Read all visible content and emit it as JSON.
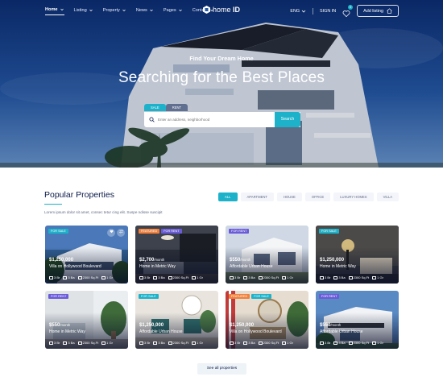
{
  "nav": {
    "items": [
      {
        "label": "Home",
        "active": true
      },
      {
        "label": "Listing",
        "active": false
      },
      {
        "label": "Property",
        "active": false
      },
      {
        "label": "News",
        "active": false
      },
      {
        "label": "Pages",
        "active": false
      },
      {
        "label": "Contact",
        "active": false
      }
    ],
    "logo": {
      "pre": "home",
      "bold": "ID"
    },
    "lang": "ENG",
    "signin": "SIGN IN",
    "wishlist_count": "0",
    "add_listing": "Add listing"
  },
  "hero": {
    "subtitle": "Find Your Dream Home",
    "title": "Searching for the Best Places",
    "tabs": [
      "SALE",
      "RENT"
    ],
    "search_placeholder": "Enter an address, neighborhood",
    "search_button": "Search"
  },
  "popular": {
    "title": "Popular Properties",
    "description": "Lorem ipsum dolor sit amet, consec tetur cing elit. Suspe ndisse suscipit",
    "filters": [
      "ALL",
      "APARTMENT",
      "HOUSE",
      "OFFICE",
      "LUXURY HOMES",
      "VILLA"
    ],
    "cards": [
      {
        "tags": [
          {
            "text": "FOR SALE",
            "kind": "sale"
          }
        ],
        "price": "$1,250,000",
        "per": "",
        "title": "Villa on Hollywood Boulevard",
        "br": "3 Br",
        "ba": "3 Ba",
        "area": "2300 Sq.Ft",
        "gr": "1 Gr",
        "actions": true,
        "photo": "villa"
      },
      {
        "tags": [
          {
            "text": "FEATURED",
            "kind": "featured"
          },
          {
            "text": "FOR RENT",
            "kind": "rent"
          }
        ],
        "price": "$2,700",
        "per": "/month",
        "title": "Home in Metric Way",
        "br": "3 Br",
        "ba": "3 Ba",
        "area": "2300 Sq.Ft",
        "gr": "1 Gr",
        "actions": false,
        "photo": "living-dark"
      },
      {
        "tags": [
          {
            "text": "FOR RENT",
            "kind": "rent"
          }
        ],
        "price": "$550",
        "per": "/month",
        "title": "Affordable Urban House",
        "br": "3 Br",
        "ba": "3 Ba",
        "area": "2300 Sq.Ft",
        "gr": "1 Gr",
        "actions": false,
        "photo": "white-house"
      },
      {
        "tags": [
          {
            "text": "FOR SALE",
            "kind": "sale"
          }
        ],
        "price": "$1,250,000",
        "per": "",
        "title": "Home in Metric Way",
        "br": "3 Br",
        "ba": "3 Ba",
        "area": "2300 Sq.Ft",
        "gr": "1 Gr",
        "actions": false,
        "photo": "lamp-room"
      },
      {
        "tags": [
          {
            "text": "FOR RENT",
            "kind": "rent"
          }
        ],
        "price": "$550",
        "per": "/month",
        "title": "Home in Metric Way",
        "br": "3 Br",
        "ba": "3 Ba",
        "area": "2300 Sq.Ft",
        "gr": "1 Gr",
        "actions": false,
        "photo": "plant-room"
      },
      {
        "tags": [
          {
            "text": "FOR SALE",
            "kind": "sale"
          }
        ],
        "price": "$1,250,000",
        "per": "",
        "title": "Affordable Urban House",
        "br": "3 Br",
        "ba": "3 Ba",
        "area": "2300 Sq.Ft",
        "gr": "1 Gr",
        "actions": false,
        "photo": "teal-chairs"
      },
      {
        "tags": [
          {
            "text": "FEATURED",
            "kind": "featured"
          },
          {
            "text": "FOR SALE",
            "kind": "sale"
          }
        ],
        "price": "$1,250,000",
        "per": "",
        "title": "Villa on Hollywood Boulevard",
        "br": "3 Br",
        "ba": "3 Ba",
        "area": "2300 Sq.Ft",
        "gr": "1 Gr",
        "actions": false,
        "photo": "mirror-room"
      },
      {
        "tags": [
          {
            "text": "FOR RENT",
            "kind": "rent"
          }
        ],
        "price": "$550",
        "per": "/month",
        "title": "Affordable Urban House",
        "br": "3 Br",
        "ba": "3 Ba",
        "area": "2300 Sq.Ft",
        "gr": "1 Gr",
        "actions": false,
        "photo": "modern-house"
      }
    ],
    "see_all": "See all properties"
  },
  "colors": {
    "accent": "#1db2c9",
    "navy": "#0b1a4a",
    "rent": "#6a5bd8",
    "featured": "#f0803c"
  }
}
